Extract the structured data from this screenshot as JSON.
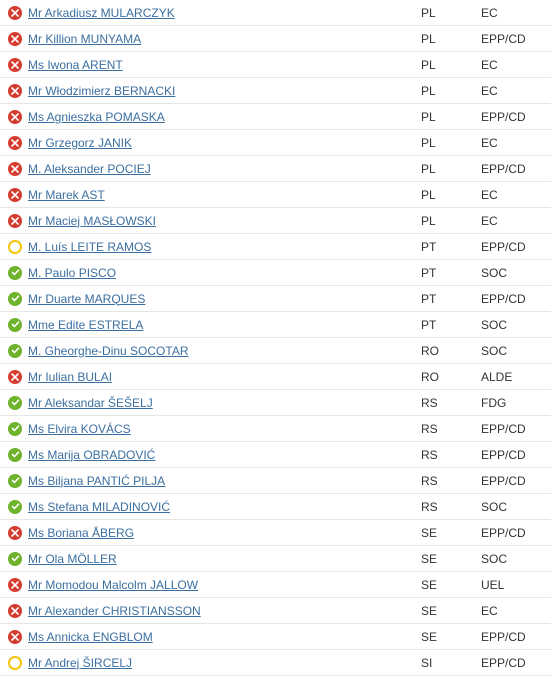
{
  "rows": [
    {
      "status": "against",
      "name": "Mr Arkadiusz MULARCZYK",
      "country": "PL",
      "group": "EC"
    },
    {
      "status": "against",
      "name": "Mr Killion MUNYAMA",
      "country": "PL",
      "group": "EPP/CD"
    },
    {
      "status": "against",
      "name": "Ms Iwona ARENT",
      "country": "PL",
      "group": "EC"
    },
    {
      "status": "against",
      "name": "Mr Włodzimierz BERNACKI",
      "country": "PL",
      "group": "EC"
    },
    {
      "status": "against",
      "name": "Ms Agnieszka POMASKA",
      "country": "PL",
      "group": "EPP/CD"
    },
    {
      "status": "against",
      "name": "Mr Grzegorz JANIK",
      "country": "PL",
      "group": "EC"
    },
    {
      "status": "against",
      "name": "M. Aleksander POCIEJ",
      "country": "PL",
      "group": "EPP/CD"
    },
    {
      "status": "against",
      "name": "Mr Marek AST",
      "country": "PL",
      "group": "EC"
    },
    {
      "status": "against",
      "name": "Mr Maciej MASŁOWSKI",
      "country": "PL",
      "group": "EC"
    },
    {
      "status": "abstain",
      "name": "M. Luís LEITE RAMOS",
      "country": "PT",
      "group": "EPP/CD"
    },
    {
      "status": "for",
      "name": "M. Paulo PISCO",
      "country": "PT",
      "group": "SOC"
    },
    {
      "status": "for",
      "name": "Mr Duarte MARQUES",
      "country": "PT",
      "group": "EPP/CD"
    },
    {
      "status": "for",
      "name": "Mme Edite ESTRELA",
      "country": "PT",
      "group": "SOC"
    },
    {
      "status": "for",
      "name": "M. Gheorghe-Dinu SOCOTAR",
      "country": "RO",
      "group": "SOC"
    },
    {
      "status": "against",
      "name": "Mr Iulian BULAI",
      "country": "RO",
      "group": "ALDE"
    },
    {
      "status": "for",
      "name": "Mr Aleksandar ŠEŠELJ",
      "country": "RS",
      "group": "FDG"
    },
    {
      "status": "for",
      "name": "Ms Elvira KOVÁCS",
      "country": "RS",
      "group": "EPP/CD"
    },
    {
      "status": "for",
      "name": "Ms Marija OBRADOVIĆ",
      "country": "RS",
      "group": "EPP/CD"
    },
    {
      "status": "for",
      "name": "Ms Biljana PANTIĆ PILJA",
      "country": "RS",
      "group": "EPP/CD"
    },
    {
      "status": "for",
      "name": "Ms Stefana MILADINOVIĆ",
      "country": "RS",
      "group": "SOC"
    },
    {
      "status": "against",
      "name": "Ms Boriana ÅBERG",
      "country": "SE",
      "group": "EPP/CD"
    },
    {
      "status": "for",
      "name": "Mr Ola MÖLLER",
      "country": "SE",
      "group": "SOC"
    },
    {
      "status": "against",
      "name": "Mr Momodou Malcolm JALLOW",
      "country": "SE",
      "group": "UEL"
    },
    {
      "status": "against",
      "name": "Mr Alexander CHRISTIANSSON",
      "country": "SE",
      "group": "EC"
    },
    {
      "status": "against",
      "name": "Ms Annicka ENGBLOM",
      "country": "SE",
      "group": "EPP/CD"
    },
    {
      "status": "abstain",
      "name": "Mr Andrej ŠIRCELJ",
      "country": "SI",
      "group": "EPP/CD"
    }
  ],
  "icons": {
    "against": "cross-icon",
    "for": "check-icon",
    "abstain": "circle-icon"
  }
}
